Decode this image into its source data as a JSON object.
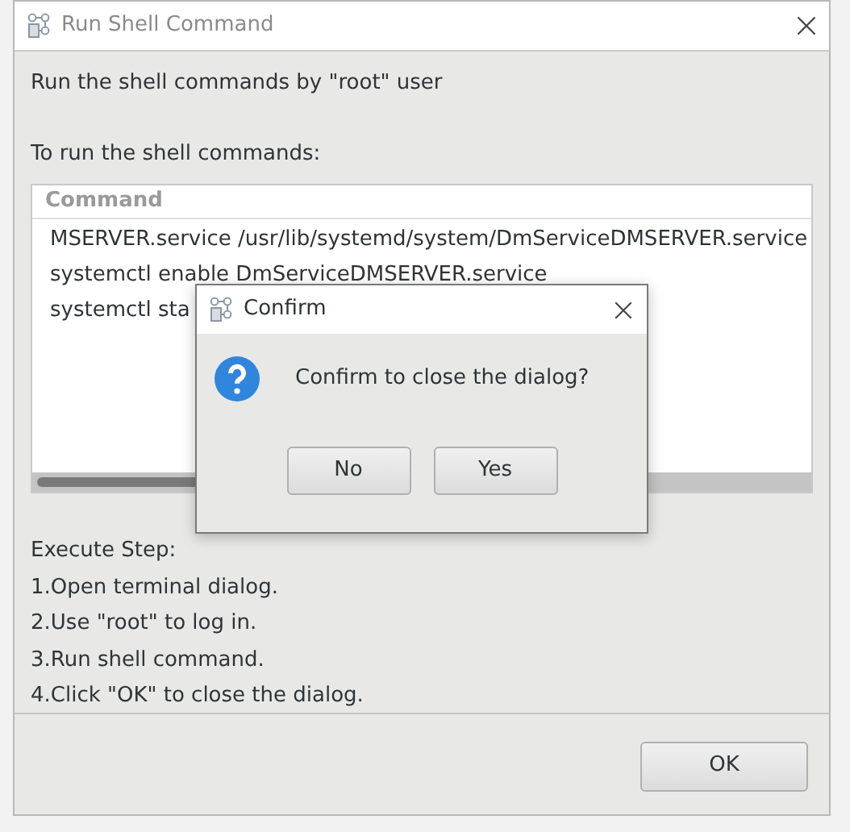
{
  "window": {
    "title": "Run Shell Command"
  },
  "intro": "Run the shell commands by \"root\" user",
  "commands_label": "To run the shell commands:",
  "table": {
    "columns": [
      "Command"
    ],
    "rows": [
      "MSERVER.service /usr/lib/systemd/system/DmServiceDMSERVER.service",
      "systemctl enable DmServiceDMSERVER.service",
      "systemctl sta"
    ]
  },
  "steps_title": "Execute Step:",
  "steps": [
    "1.Open terminal dialog.",
    "2.Use \"root\" to log in.",
    "3.Run shell command.",
    "4.Click \"OK\" to close the dialog."
  ],
  "ok_button": "OK",
  "confirm": {
    "title": "Confirm",
    "message": "Confirm to close the dialog?",
    "buttons": [
      "No",
      "Yes"
    ]
  }
}
